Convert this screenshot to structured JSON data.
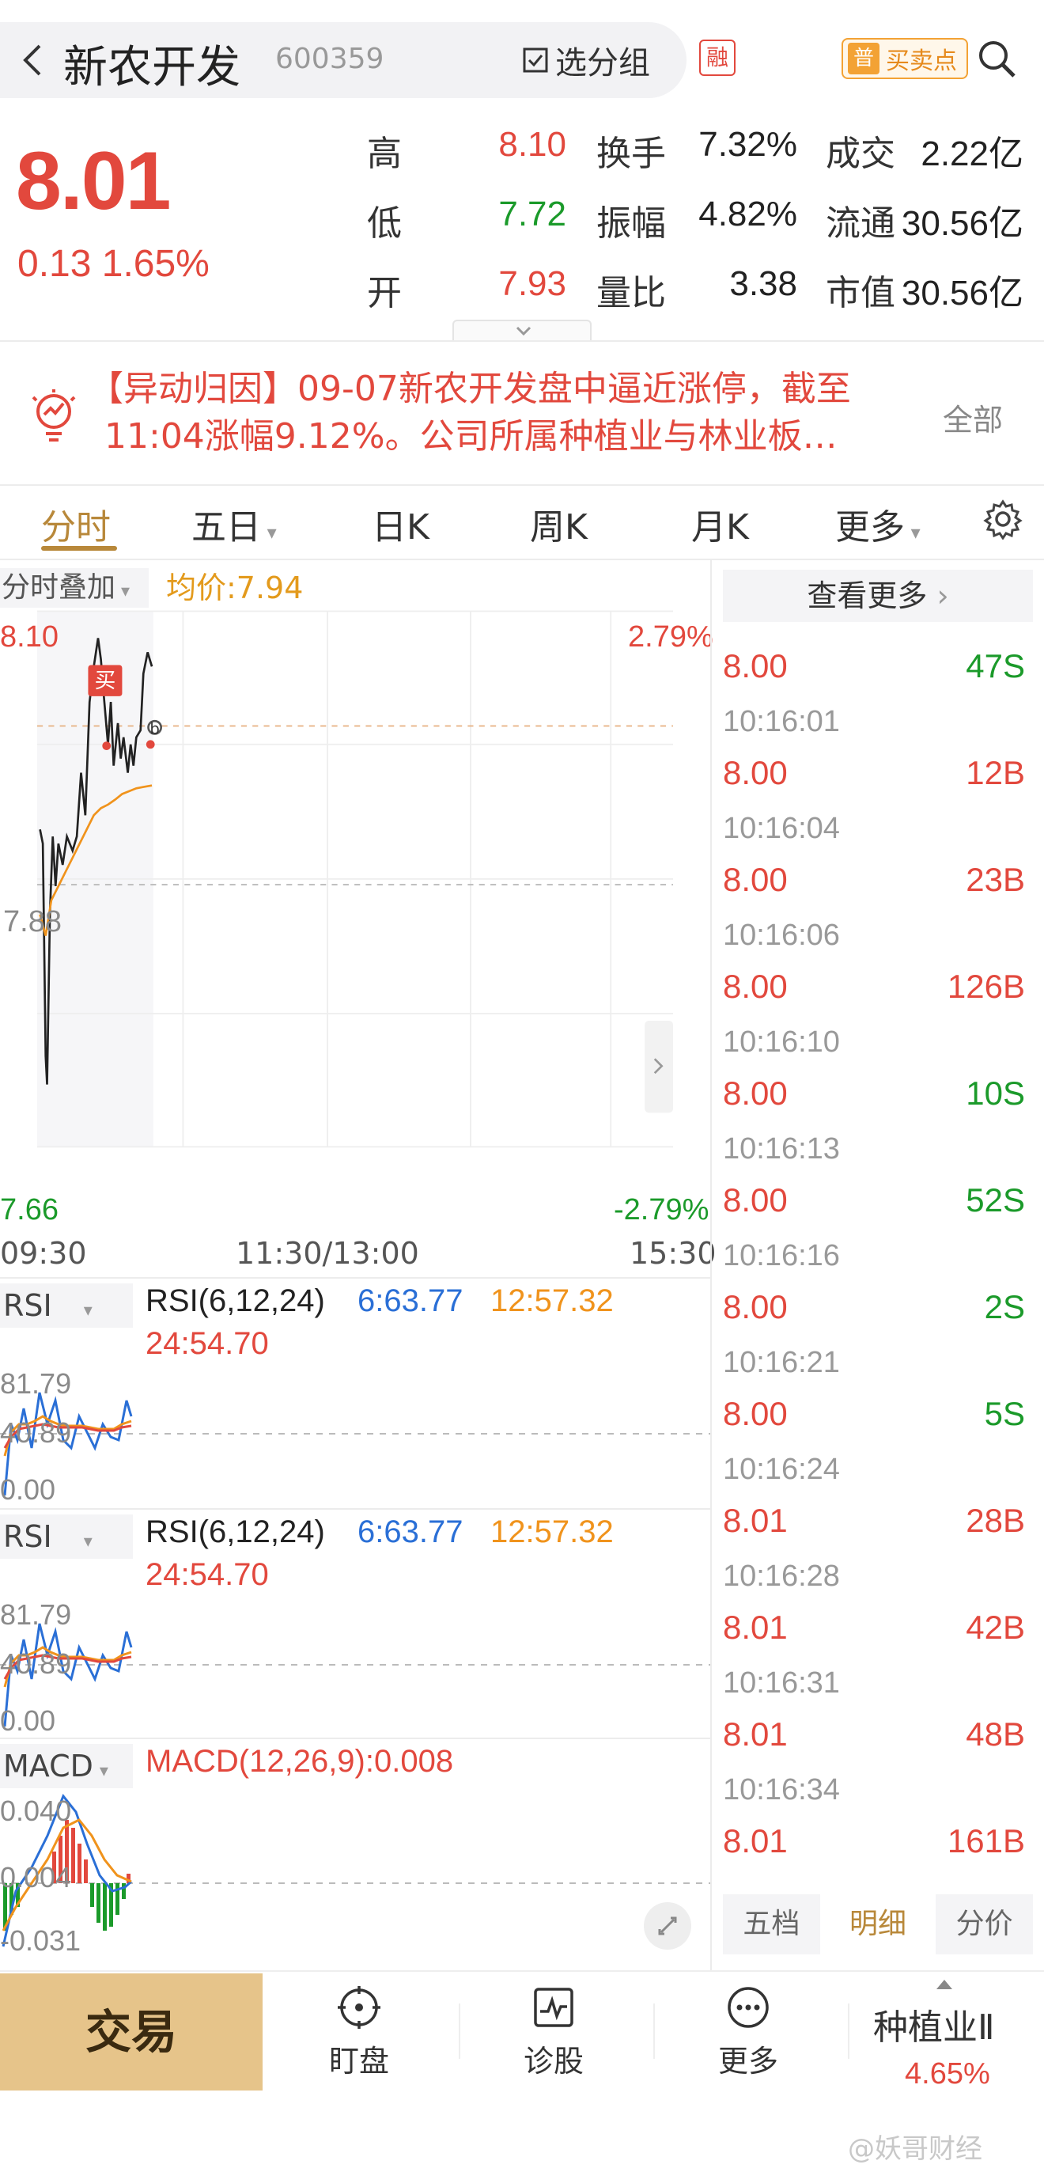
{
  "header": {
    "stock_name": "新农开发",
    "stock_code": "600359",
    "group_label": "选分组",
    "rong_badge": "融",
    "buysell_icon_text": "普",
    "buysell_label": "买卖点"
  },
  "quote": {
    "price": "8.01",
    "change": "0.13  1.65%",
    "rows": [
      [
        {
          "l": "高",
          "v": "8.10",
          "c": "red"
        },
        {
          "l": "换手",
          "v": "7.32%",
          "c": "dark"
        },
        {
          "l": "成交",
          "v": "2.22亿",
          "c": "dark"
        }
      ],
      [
        {
          "l": "低",
          "v": "7.72",
          "c": "green"
        },
        {
          "l": "振幅",
          "v": "4.82%",
          "c": "dark"
        },
        {
          "l": "流通",
          "v": "30.56亿",
          "c": "dark"
        }
      ],
      [
        {
          "l": "开",
          "v": "7.93",
          "c": "red"
        },
        {
          "l": "量比",
          "v": "3.38",
          "c": "dark"
        },
        {
          "l": "市值",
          "v": "30.56亿",
          "c": "dark"
        }
      ]
    ]
  },
  "news": {
    "line1": "【异动归因】09-07新农开发盘中逼近涨停，截至",
    "line2": "11:04涨幅9.12%。公司所属种植业与林业板…",
    "all_label": "全部"
  },
  "tabs": [
    "分时",
    "五日",
    "日K",
    "周K",
    "月K",
    "更多"
  ],
  "chart": {
    "overlay_label": "分时叠加",
    "avg_price_label": "均价:7.94",
    "price_high": "8.10",
    "price_mid": "7.88",
    "price_low": "7.66",
    "pct_high": "2.79%",
    "pct_low": "-2.79%",
    "buy_marker": "买",
    "b_marker": "b",
    "times": [
      "09:30",
      "11:30/13:00",
      "15:30"
    ]
  },
  "ticks": {
    "more_label": "查看更多",
    "rows": [
      {
        "time": "",
        "price": "8.00",
        "vol": "47S",
        "side": "S"
      },
      {
        "time": "10:16:01",
        "price": "8.00",
        "vol": "12B",
        "side": "B"
      },
      {
        "time": "10:16:04",
        "price": "8.00",
        "vol": "23B",
        "side": "B"
      },
      {
        "time": "10:16:06",
        "price": "8.00",
        "vol": "126B",
        "side": "B"
      },
      {
        "time": "10:16:10",
        "price": "8.00",
        "vol": "10S",
        "side": "S"
      },
      {
        "time": "10:16:13",
        "price": "8.00",
        "vol": "52S",
        "side": "S"
      },
      {
        "time": "10:16:16",
        "price": "8.00",
        "vol": "2S",
        "side": "S"
      },
      {
        "time": "10:16:21",
        "price": "8.00",
        "vol": "5S",
        "side": "S"
      },
      {
        "time": "10:16:24",
        "price": "8.01",
        "vol": "28B",
        "side": "B"
      },
      {
        "time": "10:16:28",
        "price": "8.01",
        "vol": "42B",
        "side": "B"
      },
      {
        "time": "10:16:31",
        "price": "8.01",
        "vol": "48B",
        "side": "B"
      },
      {
        "time": "10:16:34",
        "price": "8.01",
        "vol": "161B",
        "side": "B"
      }
    ],
    "panel_tabs": [
      "五档",
      "明细",
      "分价"
    ]
  },
  "indicators": {
    "rsi_label": "RSI",
    "rsi_params": "RSI(6,12,24)",
    "rsi6": "6:63.77",
    "rsi12": "12:57.32",
    "rsi24": "24:54.70",
    "rsi_top": "81.79",
    "rsi_mid": "40.89",
    "rsi_bot": "0.00",
    "macd_label": "MACD",
    "macd_params": "MACD(12,26,9):0.008",
    "macd_top": "0.040",
    "macd_mid": "0.004",
    "macd_bot": "-0.031"
  },
  "bottom_nav": {
    "trade": "交易",
    "watch": "盯盘",
    "diagnose": "诊股",
    "more": "更多",
    "sector_name": "种植业Ⅱ",
    "sector_change": "4.65%"
  },
  "watermark": "@妖哥财经",
  "colors": {
    "up": "#e2483d",
    "down": "#1b9a2a",
    "gold": "#b8883a",
    "avg_line": "#f0931c"
  }
}
